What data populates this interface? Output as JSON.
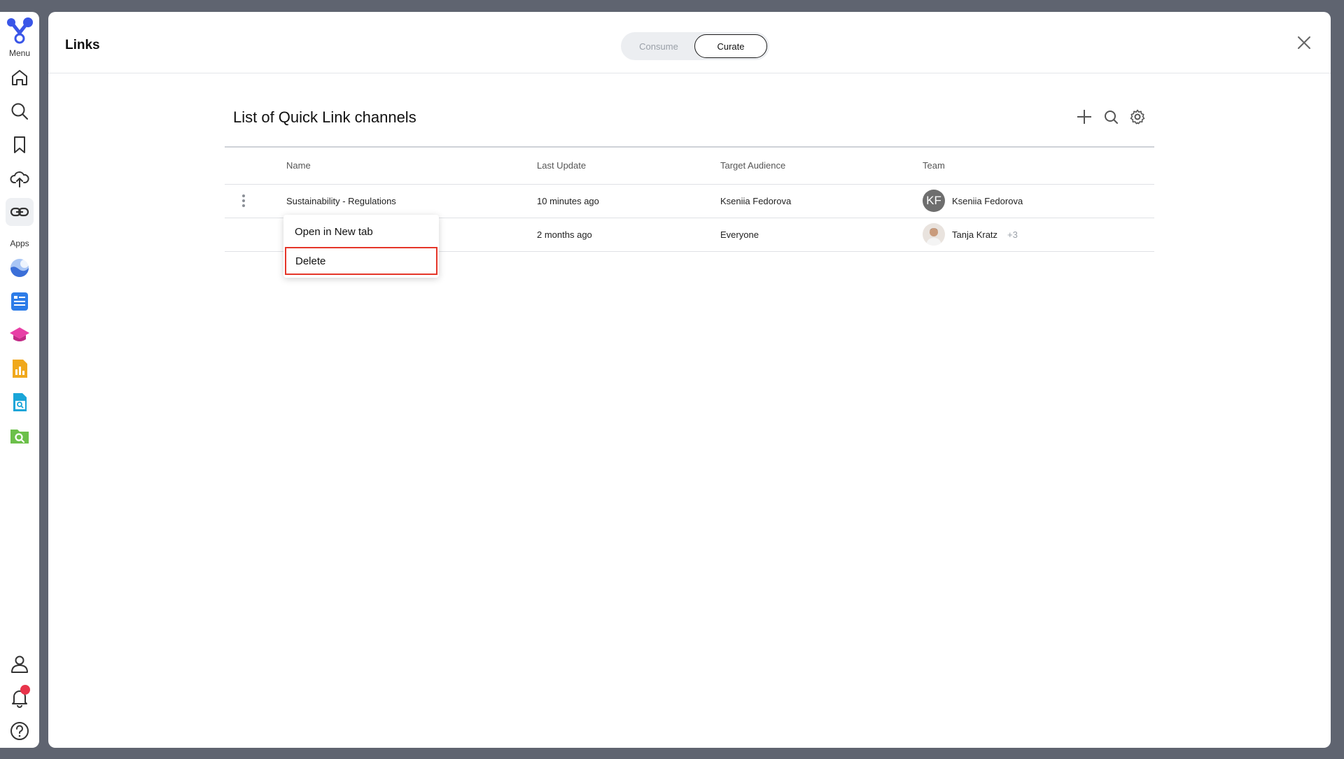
{
  "sidebar": {
    "menu_label": "Menu",
    "apps_label": "Apps",
    "menu_items": [
      {
        "icon": "home-icon"
      },
      {
        "icon": "search-icon"
      },
      {
        "icon": "bookmark-icon"
      },
      {
        "icon": "upload-cloud-icon"
      },
      {
        "icon": "link-icon",
        "active": true
      }
    ],
    "apps": [
      {
        "icon": "moon-app-icon",
        "color": "#4a8fe0"
      },
      {
        "icon": "document-list-app-icon",
        "color": "#2d7ce8"
      },
      {
        "icon": "graduation-cap-app-icon",
        "color": "#e83fa6"
      },
      {
        "icon": "bar-chart-app-icon",
        "color": "#f0a81c"
      },
      {
        "icon": "file-search-app-icon",
        "color": "#1aa5d8"
      },
      {
        "icon": "folder-search-app-icon",
        "color": "#6cc04a"
      }
    ],
    "bottom_items": [
      {
        "icon": "user-icon"
      },
      {
        "icon": "bell-icon"
      },
      {
        "icon": "help-icon"
      }
    ]
  },
  "header": {
    "title": "Links",
    "toggle": {
      "options": [
        "Consume",
        "Curate"
      ],
      "selected": "Curate"
    }
  },
  "list": {
    "title": "List of Quick Link channels",
    "columns": [
      "Name",
      "Last Update",
      "Target Audience",
      "Team"
    ],
    "rows": [
      {
        "name": "Sustainability - Regulations",
        "last_update": "10 minutes ago",
        "audience": "Kseniia Fedorova",
        "team_initials": "KF",
        "team_name": "Kseniia Fedorova",
        "team_extra": ""
      },
      {
        "name": "",
        "last_update": "2 months ago",
        "audience": "Everyone",
        "team_initials": "",
        "team_name": "Tanja Kratz",
        "team_extra": "+3"
      }
    ]
  },
  "context_menu": {
    "items": [
      "Open in New tab",
      "Delete"
    ]
  },
  "colors": {
    "accent": "#3a56e8",
    "highlight": "#e53629",
    "notification": "#e8344b"
  }
}
